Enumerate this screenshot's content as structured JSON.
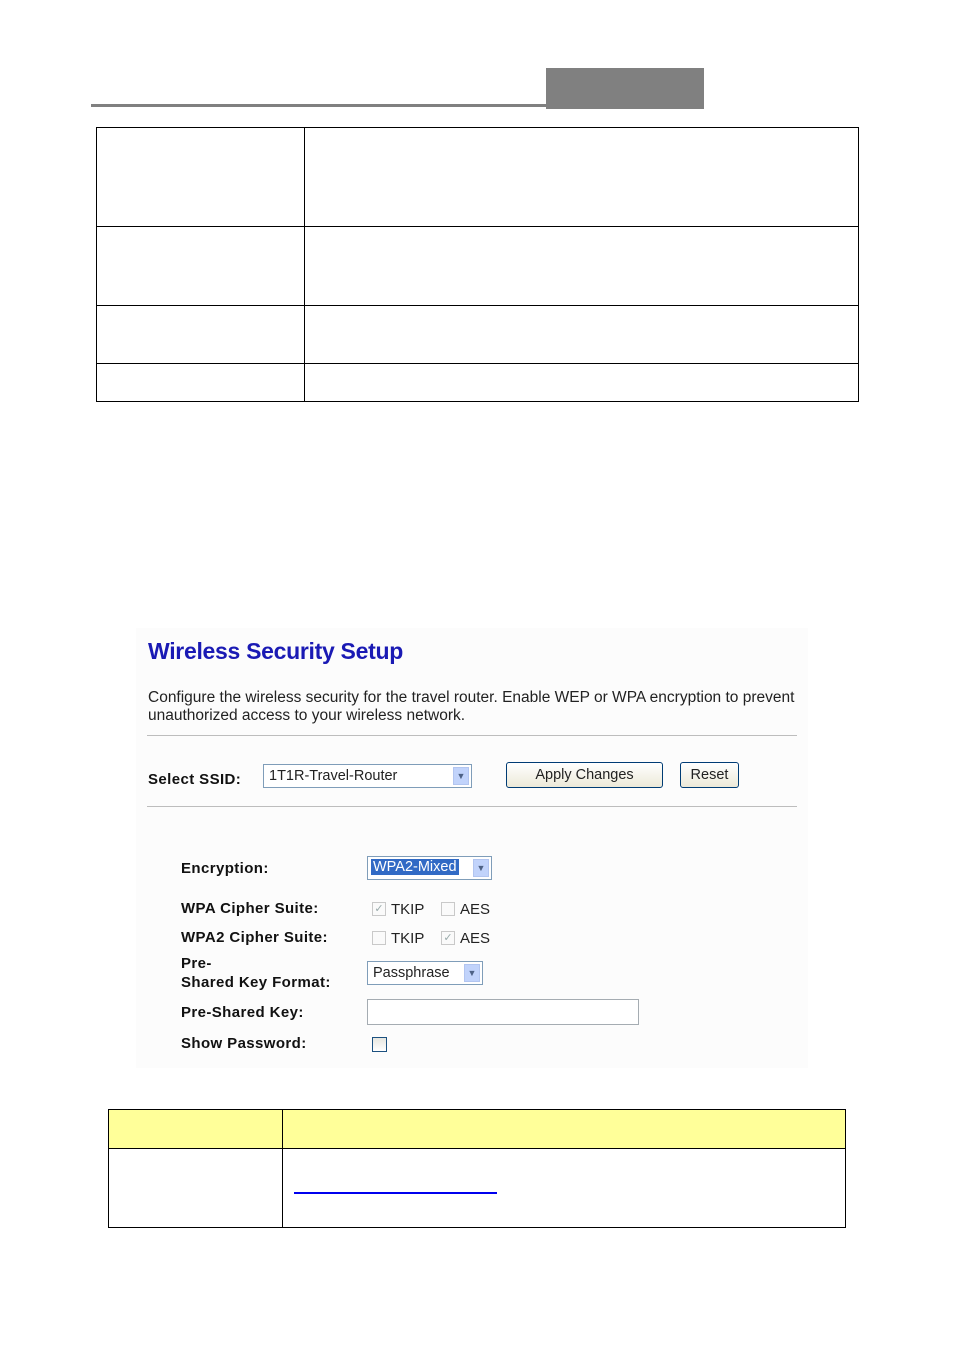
{
  "page": {
    "top_table": {
      "rows": [
        [
          "",
          ""
        ],
        [
          "",
          ""
        ],
        [
          "",
          ""
        ],
        [
          "",
          ""
        ]
      ]
    },
    "bottom_table": {
      "header": [
        "",
        ""
      ],
      "rows": [
        [
          "",
          ""
        ]
      ]
    }
  },
  "screenshot": {
    "title": "Wireless Security Setup",
    "description": "Configure the wireless security for the travel router. Enable WEP or WPA encryption to prevent unauthorized access to your wireless network.",
    "select_ssid": {
      "label": "Select SSID:",
      "value": "1T1R-Travel-Router"
    },
    "apply_button": "Apply Changes",
    "reset_button": "Reset",
    "encryption": {
      "label": "Encryption:",
      "value": "WPA2-Mixed"
    },
    "wpa_cipher": {
      "label": "WPA Cipher Suite:",
      "tkip_label": "TKIP",
      "tkip_checked": true,
      "aes_label": "AES",
      "aes_checked": false
    },
    "wpa2_cipher": {
      "label": "WPA2 Cipher Suite:",
      "tkip_label": "TKIP",
      "tkip_checked": false,
      "aes_label": "AES",
      "aes_checked": true
    },
    "psk_format": {
      "label_line1": "Pre-",
      "label_line2": "Shared Key Format:",
      "value": "Passphrase"
    },
    "psk": {
      "label": "Pre-Shared Key:",
      "value": ""
    },
    "show_password": {
      "label": "Show Password:",
      "checked": false
    },
    "icons": {
      "dropdown": "chevron-down-icon",
      "check": "checkmark-icon"
    }
  },
  "colors": {
    "title_blue": "#1a1ab4",
    "header_yellow": "#ffff99",
    "link_blue": "#0000ee",
    "header_gray": "#808080"
  }
}
